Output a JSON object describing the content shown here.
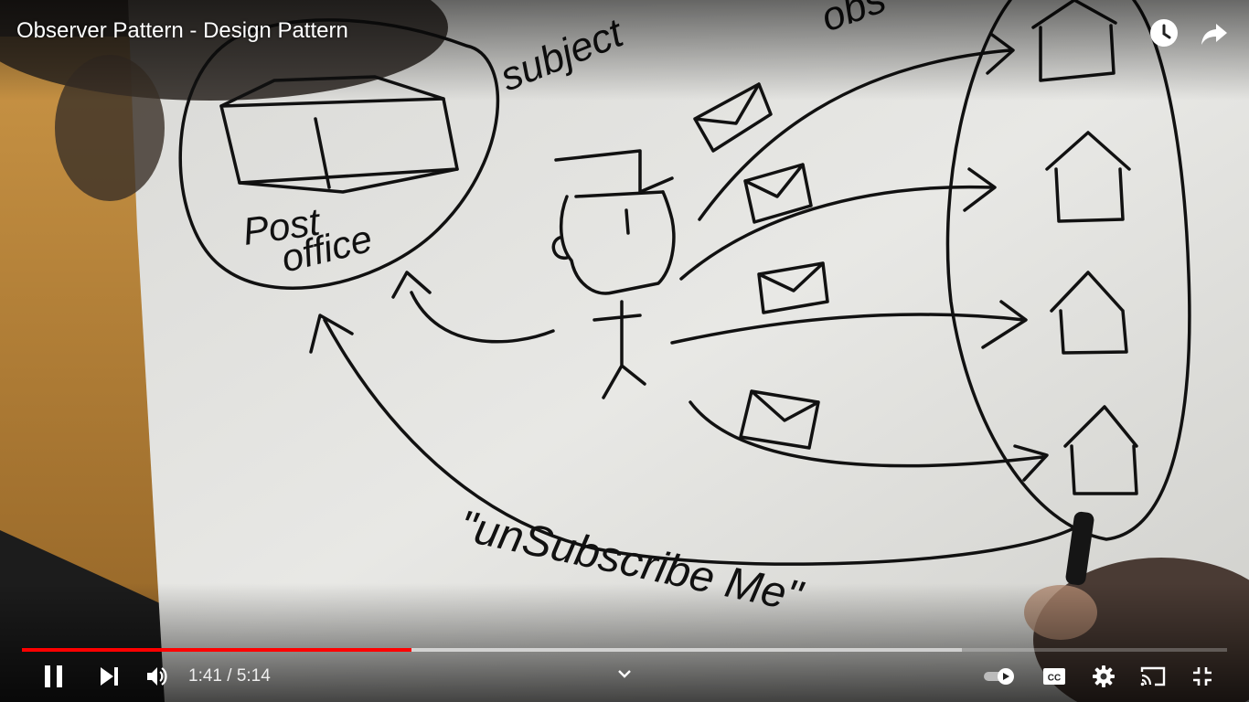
{
  "video": {
    "title": "Observer Pattern - Design Pattern",
    "current_time": "1:41",
    "separator": " / ",
    "duration": "5:14",
    "progress_played": 0.323,
    "progress_buffered": 0.78
  },
  "drawing_text": {
    "post_office_line1": "Post",
    "post_office_line2": "office",
    "subject_label": "subject",
    "observers_label": "obs",
    "unsubscribe": "\"unSubscribe Me\""
  },
  "icons": {
    "watch_later": "clock-icon",
    "share": "share-icon",
    "pause": "pause-icon",
    "next": "next-icon",
    "volume": "volume-icon",
    "chapters": "chevron-down-icon",
    "autoplay": "autoplay-toggle-icon",
    "captions": "cc-icon",
    "settings": "gear-icon",
    "cast": "cast-icon",
    "fullscreen_exit": "exit-fullscreen-icon"
  },
  "colors": {
    "progress_played": "#ff0000",
    "paper": "#e6e6e3",
    "ink": "#111111",
    "table": "#c58a3a"
  }
}
